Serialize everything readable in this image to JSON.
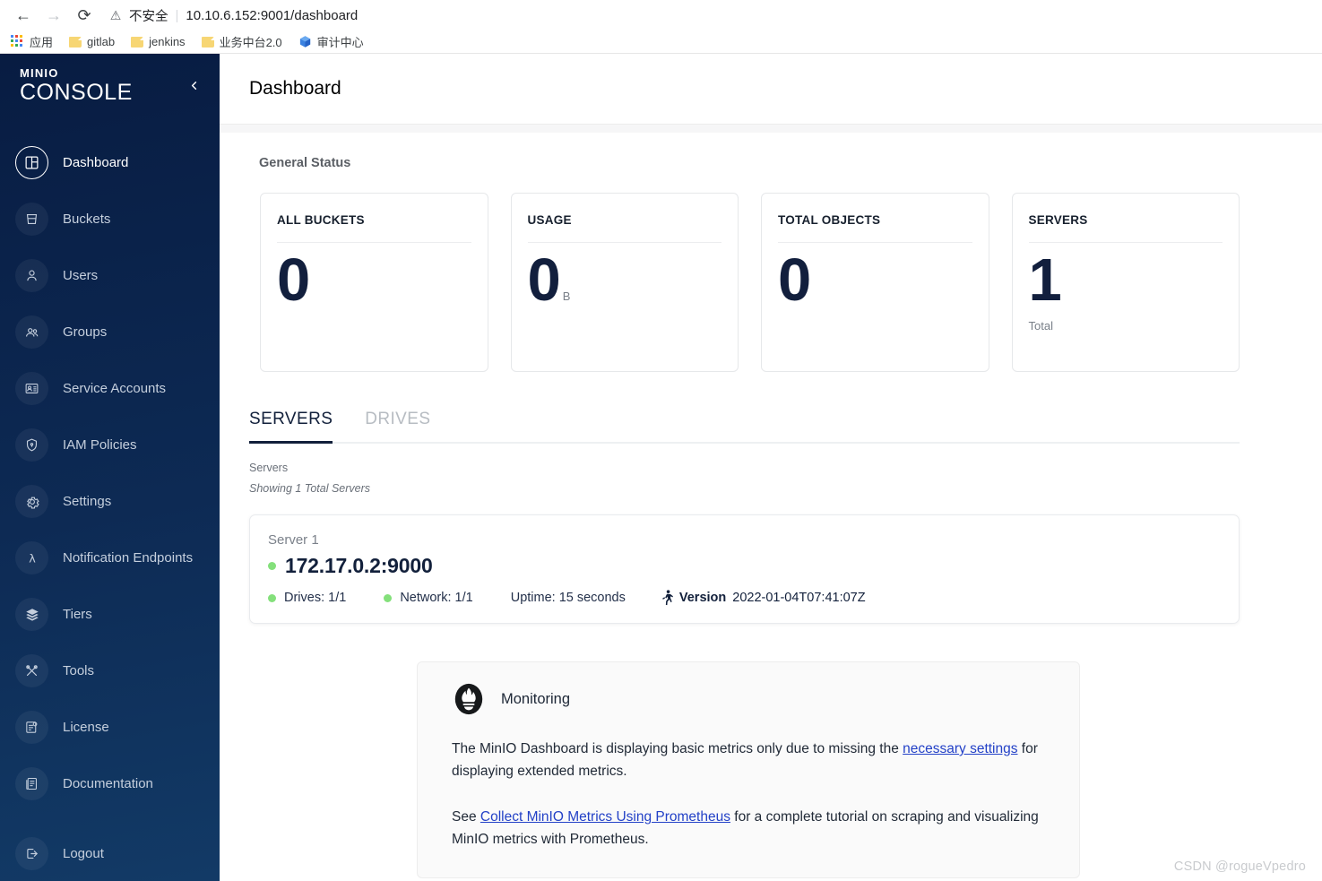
{
  "browser": {
    "back_icon": "back-arrow-icon",
    "forward_icon": "forward-arrow-icon",
    "reload_icon": "reload-icon",
    "security_label": "不安全",
    "url": "10.10.6.152:9001/dashboard",
    "bookmarks": [
      {
        "label": "应用",
        "icon": "apps-grid-icon"
      },
      {
        "label": "gitlab",
        "icon": "folder-icon"
      },
      {
        "label": "jenkins",
        "icon": "folder-icon"
      },
      {
        "label": "业务中台2.0",
        "icon": "folder-icon"
      },
      {
        "label": "审计中心",
        "icon": "cube-icon"
      }
    ]
  },
  "sidebar": {
    "brand_mini": "MINIO",
    "brand_name": "CONSOLE",
    "collapse_icon": "chevron-left-icon",
    "items": [
      {
        "label": "Dashboard",
        "icon": "dashboard-icon",
        "active": true
      },
      {
        "label": "Buckets",
        "icon": "bucket-icon",
        "active": false
      },
      {
        "label": "Users",
        "icon": "user-icon",
        "active": false
      },
      {
        "label": "Groups",
        "icon": "groups-icon",
        "active": false
      },
      {
        "label": "Service Accounts",
        "icon": "service-accounts-icon",
        "active": false
      },
      {
        "label": "IAM Policies",
        "icon": "shield-icon",
        "active": false
      },
      {
        "label": "Settings",
        "icon": "gear-icon",
        "active": false
      },
      {
        "label": "Notification Endpoints",
        "icon": "lambda-icon",
        "active": false
      },
      {
        "label": "Tiers",
        "icon": "layers-icon",
        "active": false
      },
      {
        "label": "Tools",
        "icon": "tools-icon",
        "active": false
      },
      {
        "label": "License",
        "icon": "license-icon",
        "active": false
      },
      {
        "label": "Documentation",
        "icon": "book-icon",
        "active": false
      }
    ],
    "logout": {
      "label": "Logout",
      "icon": "logout-icon"
    }
  },
  "header": {
    "title": "Dashboard"
  },
  "general_status": {
    "title": "General Status",
    "cards": [
      {
        "label": "ALL BUCKETS",
        "value": "0",
        "unit": "",
        "sub": ""
      },
      {
        "label": "USAGE",
        "value": "0",
        "unit": "B",
        "sub": ""
      },
      {
        "label": "TOTAL OBJECTS",
        "value": "0",
        "unit": "",
        "sub": ""
      },
      {
        "label": "SERVERS",
        "value": "1",
        "unit": "",
        "sub": "Total"
      }
    ]
  },
  "tabs": [
    {
      "label": "SERVERS",
      "active": true
    },
    {
      "label": "DRIVES",
      "active": false
    }
  ],
  "servers_section": {
    "label": "Servers",
    "showing": "Showing 1 Total Servers",
    "server": {
      "name": "Server 1",
      "address": "172.17.0.2:9000",
      "status_color": "#84e07b",
      "drives": "Drives: 1/1",
      "network": "Network: 1/1",
      "uptime": "Uptime: 15 seconds",
      "version_label": "Version",
      "version_value": "2022-01-04T07:41:07Z",
      "version_icon": "runner-icon"
    }
  },
  "monitoring": {
    "icon": "prometheus-icon",
    "title": "Monitoring",
    "p1_before": "The MinIO Dashboard is displaying basic metrics only due to missing the ",
    "p1_link": "necessary settings",
    "p1_after": " for displaying extended metrics.",
    "p2_before": "See ",
    "p2_link": "Collect MinIO Metrics Using Prometheus",
    "p2_after": " for a complete tutorial on scraping and visualizing MinIO metrics with Prometheus."
  },
  "watermark": "CSDN @rogueVpedro",
  "colors": {
    "sidebar_top": "#081c42",
    "sidebar_bottom": "#123a66",
    "accent_navy": "#12203b",
    "status_green": "#84e07b",
    "link_blue": "#2341c7"
  }
}
